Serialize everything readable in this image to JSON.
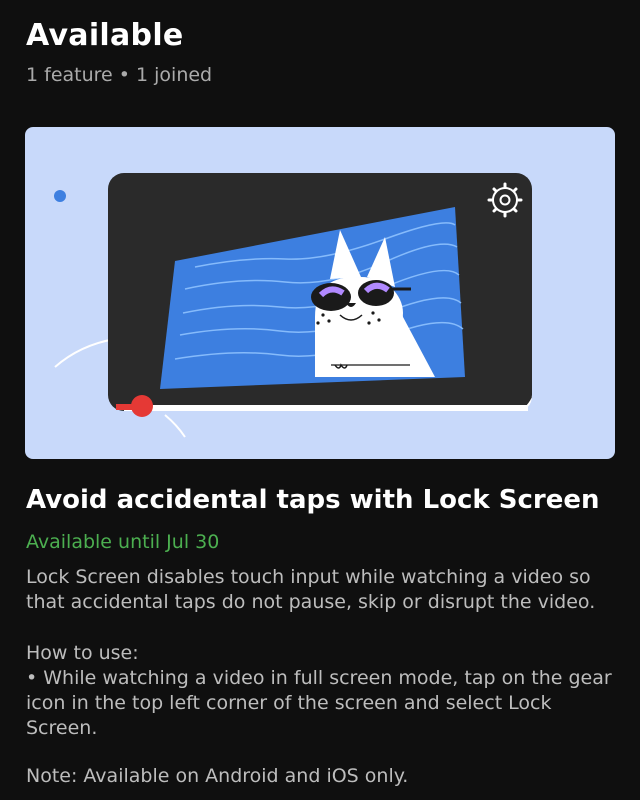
{
  "header": {
    "title": "Available",
    "subtitle": "1 feature • 1 joined"
  },
  "feature": {
    "title": "Avoid accidental taps with Lock Screen",
    "availability": "Available until Jul 30",
    "description": "Lock Screen disables touch input while watching a video so that accidental taps do not pause, skip or disrupt the video.",
    "howto_heading": "How to use:",
    "howto_step": "• While watching a video in full screen mode, tap on the gear icon in the top left corner of the screen and select Lock Screen.",
    "note": "Note: Available on Android and iOS only.",
    "illustration": {
      "background_color": "#c8d9fa",
      "video_color": "#2a2a2a",
      "scene_color": "#3d7fe0",
      "progress_color": "#e53935",
      "accent_color": "#4caf50",
      "settings_icon": "gear-icon"
    }
  }
}
